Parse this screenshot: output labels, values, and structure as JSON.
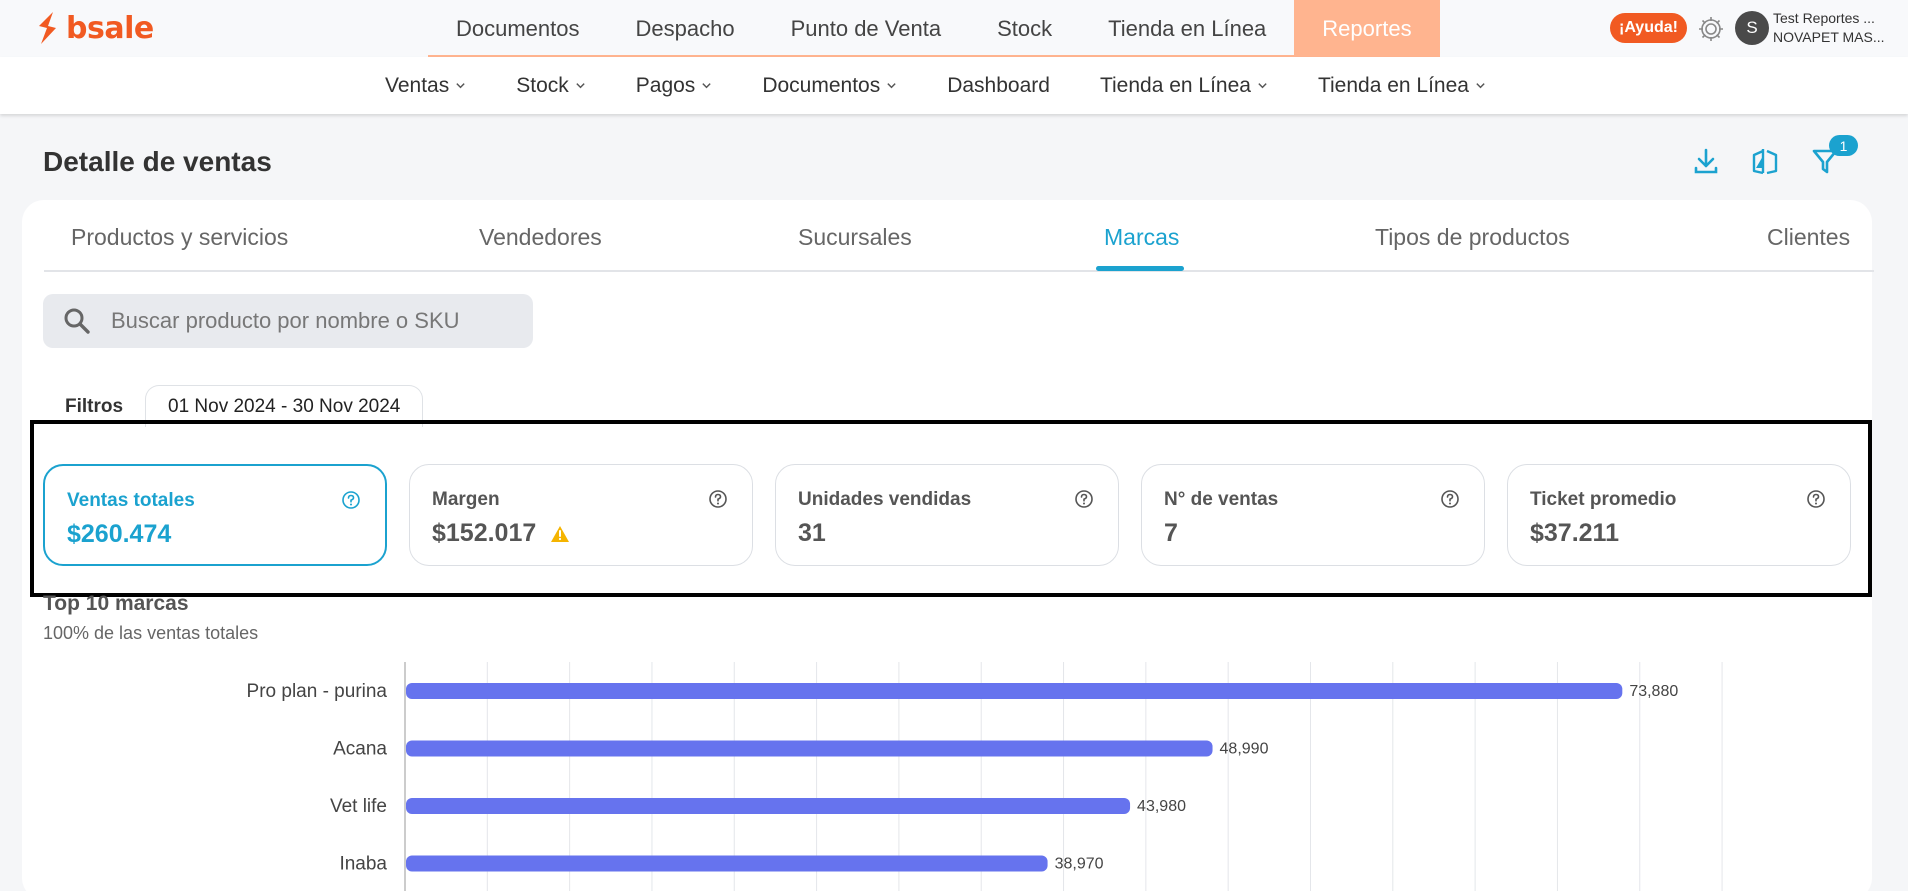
{
  "brand": {
    "name": "bsale",
    "accent": "#f15a22",
    "primary": "#1ba2cf",
    "bar_color": "#6673ee"
  },
  "main_nav": [
    {
      "label": "Documentos"
    },
    {
      "label": "Despacho"
    },
    {
      "label": "Punto de Venta"
    },
    {
      "label": "Stock"
    },
    {
      "label": "Tienda en Línea"
    },
    {
      "label": "Reportes",
      "active": true
    }
  ],
  "header_right": {
    "help": "¡Ayuda!",
    "avatar_initial": "S",
    "user_name": "Test Reportes ...",
    "company": "NOVAPET MAS..."
  },
  "sub_nav": [
    {
      "label": "Ventas",
      "dropdown": true
    },
    {
      "label": "Stock",
      "dropdown": true
    },
    {
      "label": "Pagos",
      "dropdown": true
    },
    {
      "label": "Documentos",
      "dropdown": true
    },
    {
      "label": "Dashboard",
      "dropdown": false
    },
    {
      "label": "Tienda en Línea",
      "dropdown": true
    },
    {
      "label": "Tienda en Línea",
      "dropdown": true
    }
  ],
  "page": {
    "title": "Detalle de ventas",
    "filter_count": "1"
  },
  "tabs": [
    {
      "label": "Productos y servicios"
    },
    {
      "label": "Vendedores"
    },
    {
      "label": "Sucursales"
    },
    {
      "label": "Marcas",
      "active": true
    },
    {
      "label": "Tipos de productos"
    },
    {
      "label": "Clientes"
    }
  ],
  "search": {
    "placeholder": "Buscar producto por nombre o SKU",
    "value": ""
  },
  "filters": {
    "label": "Filtros",
    "date_range": "01 Nov 2024 - 30 Nov 2024"
  },
  "kpis": [
    {
      "label": "Ventas totales",
      "value": "$260.474",
      "active": true
    },
    {
      "label": "Margen",
      "value": "$152.017",
      "warning": true
    },
    {
      "label": "Unidades vendidas",
      "value": "31"
    },
    {
      "label": "N° de ventas",
      "value": "7"
    },
    {
      "label": "Ticket promedio",
      "value": "$37.211"
    }
  ],
  "chart_header": {
    "title": "Top 10 marcas",
    "subtitle": "100% de las ventas totales"
  },
  "chart_data": {
    "type": "bar",
    "orientation": "horizontal",
    "categories": [
      "Pro plan - purina",
      "Acana",
      "Vet life",
      "Inaba"
    ],
    "values": [
      73880,
      48990,
      43980,
      38970
    ],
    "value_labels": [
      "73,880",
      "48,990",
      "43,980",
      "38,970"
    ],
    "xlim": [
      0,
      80000
    ],
    "grid": true
  }
}
